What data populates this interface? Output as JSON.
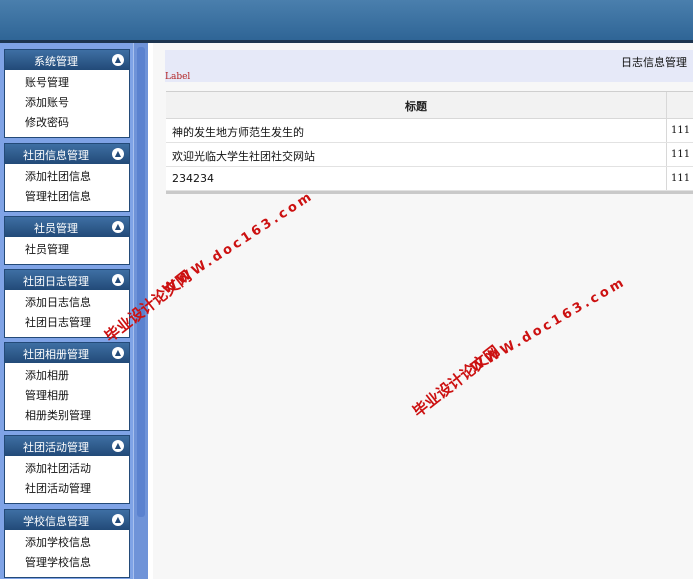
{
  "sidebar": {
    "panels": [
      {
        "title": "系统管理",
        "items": [
          "账号管理",
          "添加账号",
          "修改密码"
        ]
      },
      {
        "title": "社团信息管理",
        "items": [
          "添加社团信息",
          "管理社团信息"
        ]
      },
      {
        "title": "社员管理",
        "items": [
          "社员管理"
        ]
      },
      {
        "title": "社团日志管理",
        "items": [
          "添加日志信息",
          "社团日志管理"
        ]
      },
      {
        "title": "社团相册管理",
        "items": [
          "添加相册",
          "管理相册",
          "相册类别管理"
        ]
      },
      {
        "title": "社团活动管理",
        "items": [
          "添加社团活动",
          "社团活动管理"
        ]
      },
      {
        "title": "学校信息管理",
        "items": [
          "添加学校信息",
          "管理学校信息"
        ]
      }
    ]
  },
  "main": {
    "page_title": "日志信息管理",
    "label": "Label",
    "table": {
      "header": "标题",
      "rows": [
        {
          "title": "神的发生地方师范生发生的",
          "value": "111"
        },
        {
          "title": "欢迎光临大学生社团社交网站",
          "value": "111"
        },
        {
          "title": "234234",
          "value": "111"
        }
      ]
    }
  },
  "watermark": {
    "cn": "毕业设计论文网",
    "url": "WWW.doc163.com"
  },
  "colors": {
    "topbar": "#2f6596",
    "sidebar": "#7fa3e6",
    "panel_header": "#224a78",
    "label_red": "#b22222",
    "watermark_red": "#cc1111"
  }
}
